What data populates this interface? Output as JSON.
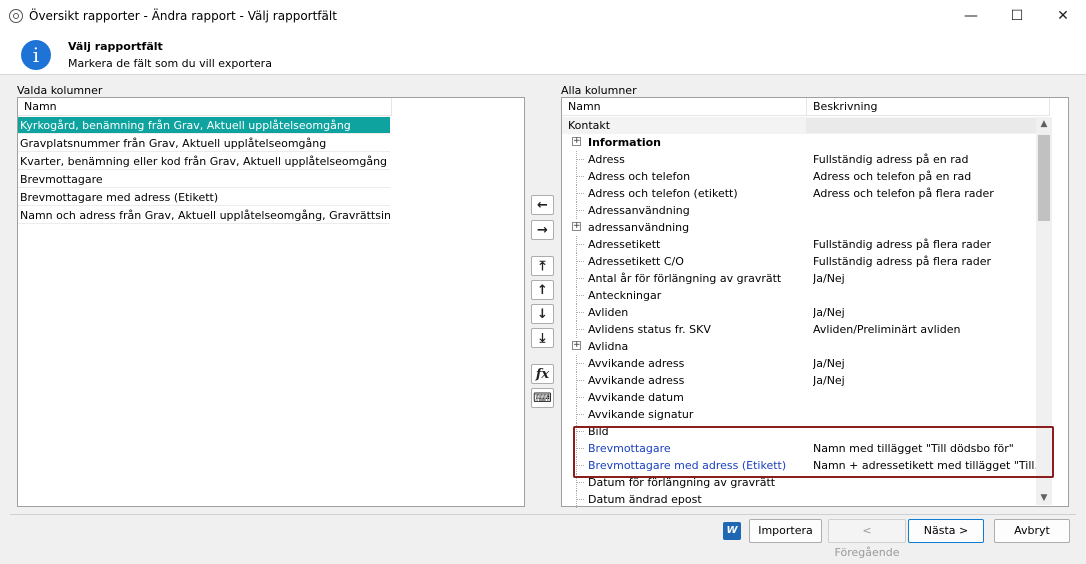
{
  "window": {
    "title": "Översikt rapporter - Ändra rapport - Välj rapportfält",
    "minimize": "—",
    "maximize": "☐",
    "close": "✕"
  },
  "header": {
    "title": "Välj rapportfält",
    "subtitle": "Markera de fält som du vill exportera",
    "icon": "i"
  },
  "left": {
    "label": "Valda kolumner",
    "column": "Namn",
    "rows": [
      "Kyrkogård, benämning från Grav, Aktuell upplåtelseomgång",
      "Gravplatsnummer från Grav, Aktuell upplåtelseomgång",
      "Kvarter, benämning eller kod från Grav, Aktuell upplåtelseomgång",
      "Brevmottagare",
      "Brevmottagare med adress (Etikett)",
      "Namn och adress från Grav, Aktuell upplåtelseomgång, Gravrättsinnehavare"
    ]
  },
  "right": {
    "label": "Alla kolumner",
    "col_name": "Namn",
    "col_desc": "Beskrivning",
    "group": "Kontakt",
    "rows": [
      {
        "name": "Information",
        "desc": "",
        "expand": "+"
      },
      {
        "name": "Adress",
        "desc": "Fullständig adress på en rad"
      },
      {
        "name": "Adress och telefon",
        "desc": "Adress och telefon på en rad"
      },
      {
        "name": "Adress och telefon (etikett)",
        "desc": "Adress och telefon på flera rader"
      },
      {
        "name": "Adressanvändning",
        "desc": ""
      },
      {
        "name": "adressanvändning",
        "desc": "",
        "expand": "+"
      },
      {
        "name": "Adressetikett",
        "desc": "Fullständig adress på flera rader"
      },
      {
        "name": "Adressetikett C/O",
        "desc": "Fullständig adress på flera rader"
      },
      {
        "name": "Antal år för förlängning av gravrätt",
        "desc": "Ja/Nej"
      },
      {
        "name": "Anteckningar",
        "desc": ""
      },
      {
        "name": "Avliden",
        "desc": "Ja/Nej"
      },
      {
        "name": "Avlidens status fr. SKV",
        "desc": "Avliden/Preliminärt avliden"
      },
      {
        "name": "Avlidna",
        "desc": "",
        "expand": "+"
      },
      {
        "name": "Avvikande adress",
        "desc": "Ja/Nej"
      },
      {
        "name": "Avvikande adress",
        "desc": "Ja/Nej"
      },
      {
        "name": "Avvikande datum",
        "desc": ""
      },
      {
        "name": "Avvikande signatur",
        "desc": ""
      },
      {
        "name": "Bild",
        "desc": ""
      },
      {
        "name": "Brevmottagare",
        "desc": "Namn med tillägget \"Till dödsbo för\""
      },
      {
        "name": "Brevmottagare med adress (Etikett)",
        "desc": "Namn + adressetikett med tillägget \"Till dödsbo för\""
      },
      {
        "name": "Datum för förlängning av gravrätt",
        "desc": ""
      },
      {
        "name": "Datum ändrad epost",
        "desc": ""
      }
    ]
  },
  "side_buttons": {
    "remove": "←",
    "add": "→",
    "top": "⤒",
    "up": "↑",
    "down": "↓",
    "bottom": "⤓",
    "fx": "fx",
    "keyboard": "⌨"
  },
  "footer": {
    "word_icon": "W",
    "import": "Importera",
    "prev": "< Föregående",
    "next": "Nästa  >",
    "cancel": "Avbryt"
  },
  "colors": {
    "selection": "#0fa3a0",
    "link_blue": "#1a3fbf",
    "highlight_box": "#8b1d1d",
    "info_icon": "#1e74d6"
  }
}
